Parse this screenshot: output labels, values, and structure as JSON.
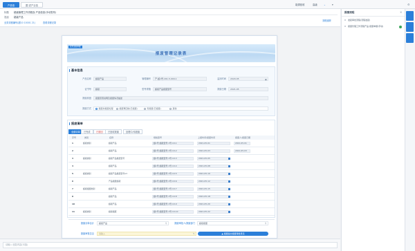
{
  "toolbar": {
    "tabs": [
      "产品信",
      "图·述产业信"
    ],
    "right_items": [
      "能源回收",
      "高级",
      "更多"
    ]
  },
  "header": {
    "title_label": "标题",
    "title_value": "超级管理工作流程及·产品信息(手动发布)",
    "owner_label": "发起",
    "owner_value": "超级产品",
    "link_left": "业务流程编号(超10 10001 21)",
    "link_mid": "查看流程记录",
    "link_right": "流程追踪"
  },
  "document": {
    "banner_small": "业务流程单据",
    "banner_title": "报废管理记录表",
    "section1_title": "基本信息",
    "fields": [
      {
        "label": "产品名称",
        "value": "超级产品"
      },
      {
        "label": "管理编号",
        "value": "产-超1号-201-5-000-1"
      },
      {
        "label": "监测时间",
        "value": "2020-05"
      },
      {
        "label": "证书号",
        "value": "超级"
      },
      {
        "label": "型号规格",
        "value": "超级产品报废型号"
      },
      {
        "label": "报废日期",
        "value": "2021-05"
      },
      {
        "label": "报废原因",
        "value": "报废原因说明及报废情况描述"
      }
    ],
    "radio_label": "报废方式",
    "radios": [
      "报废并报废处理",
      "报废再回收(已报废)",
      "有报废(已报废)",
      "其他"
    ],
    "section2_title": "报废清单",
    "list_tabs": [
      "全部清单",
      "已完成",
      "已退回",
      "已回收报废",
      "处理中/待报废"
    ],
    "table_headers": [
      "序号",
      "类别",
      "名称",
      "规格型号",
      "上报时间/报废时间",
      "报废人/报废日期"
    ],
    "rows": [
      {
        "no": "1",
        "cat": "超级类别",
        "name": "超级产品",
        "spec": "超1号-超级型号-1号-10-1",
        "date": "2021-05-01",
        "person": "2021-05-01"
      },
      {
        "no": "2",
        "cat": "",
        "name": "超级产品",
        "spec": "超1号-超级型号-1号-10-2",
        "date": "2021-05-03",
        "person": "2021-05-03"
      },
      {
        "no": "3",
        "cat": "超级类别",
        "name": "超级产品报废型号",
        "spec": "超1号-超级型号-1号-10-3",
        "date": "2021-05-05",
        "person": ""
      },
      {
        "no": "4",
        "cat": "",
        "name": "超级产品",
        "spec": "超1号-超级型号-1号-10-4",
        "date": "2021-05-08",
        "person": ""
      },
      {
        "no": "5",
        "cat": "超级类别",
        "name": "超级产品报废型号A3",
        "spec": "超1号-超级型号-1号-10-5",
        "date": "2021-05-10",
        "person": ""
      },
      {
        "no": "6",
        "cat": "",
        "name": "产品报废超级",
        "spec": "超1号-超级型号-1号-10-6",
        "date": "2021-05-12",
        "person": ""
      },
      {
        "no": "7",
        "cat": "超级报废类别",
        "name": "超级产品",
        "spec": "超1号-超级型号-1号-10-7",
        "date": "2021-05-15",
        "person": ""
      },
      {
        "no": "8",
        "cat": "",
        "name": "超级产品",
        "spec": "超1号-超级型号-1号-10-8",
        "date": "2021-05-18",
        "person": ""
      },
      {
        "no": "10",
        "cat": "",
        "name": "超级产品",
        "spec": "超1号-超级型号-1号-10-9",
        "date": "2021-05-20",
        "person": ""
      },
      {
        "no": "11",
        "cat": "超级类别",
        "name": "超级报废",
        "spec": "超1号-超级型号-1号-10-10",
        "date": "2021-05-22",
        "person": ""
      }
    ],
    "sum_label": "报废清单合计",
    "sum_value": "超级产品",
    "approver_label": "报废审批人/报废部门",
    "approver_value": "超级报废",
    "opinion_label": "报废审核意见",
    "opinion_placeholder": "请输入",
    "submit_label": "▲ 报废提交报废审批意见"
  },
  "footer": {
    "input_placeholder": "请输入·回复内容(可选)"
  },
  "right_panel": {
    "title": "报废流程",
    "step1": "发起审批流程(流程发起)",
    "step2": "报废管理工作流程产品·报废单据(手动)"
  },
  "colors": {
    "accent": "#2b7fd9",
    "banner": "#c6dff5"
  }
}
